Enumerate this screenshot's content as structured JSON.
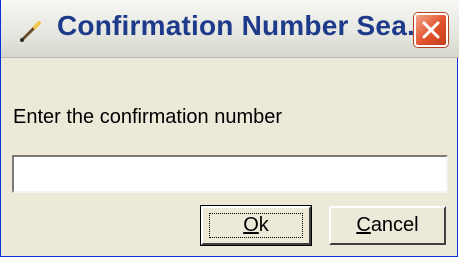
{
  "dialog": {
    "title": "Confirmation Number Sea...",
    "title_icon": "pencil-icon",
    "close_icon": "close-icon",
    "prompt": "Enter the confirmation number",
    "input": {
      "value": "",
      "placeholder": ""
    },
    "buttons": {
      "ok": {
        "mnemonic": "O",
        "rest": "k"
      },
      "cancel": {
        "mnemonic": "C",
        "rest": "ancel"
      }
    }
  },
  "colors": {
    "title_text": "#1e3a8a",
    "close_button": "#e1522c",
    "dialog_background": "#ece9d8"
  }
}
